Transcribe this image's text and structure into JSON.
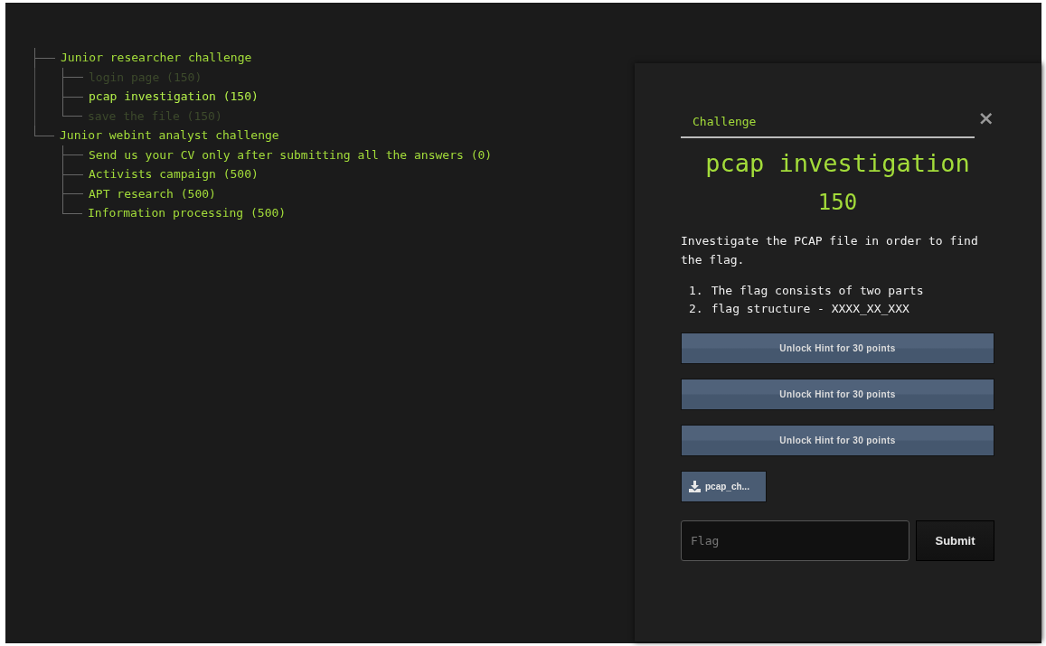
{
  "tree": [
    {
      "label": "Junior researcher challenge",
      "children": [
        {
          "label": "login page (150)",
          "disabled": true,
          "selected": false
        },
        {
          "label": "pcap investigation (150)",
          "disabled": false,
          "selected": true
        },
        {
          "label": "save the file (150)",
          "disabled": true,
          "selected": false
        }
      ]
    },
    {
      "label": "Junior webint analyst challenge",
      "children": [
        {
          "label": "Send us your CV only after submitting all the answers (0)",
          "disabled": false,
          "selected": false
        },
        {
          "label": "Activists campaign (500)",
          "disabled": false,
          "selected": false
        },
        {
          "label": "APT research (500)",
          "disabled": false,
          "selected": false
        },
        {
          "label": "Information processing (500)",
          "disabled": false,
          "selected": false
        }
      ]
    }
  ],
  "modal": {
    "header": "Challenge",
    "close": "×",
    "title": "pcap investigation",
    "points": "150",
    "description": "Investigate the PCAP file in order to find the flag.",
    "notes": [
      {
        "number": "1.",
        "text": "The flag consists of two parts"
      },
      {
        "number": "2.",
        "text": "flag structure - XXXX_XX_XXX"
      }
    ],
    "hints": [
      "Unlock Hint for 30 points",
      "Unlock Hint for 30 points",
      "Unlock Hint for 30 points"
    ],
    "file": "pcap_ch...",
    "flag": {
      "placeholder": "Flag"
    },
    "submit": "Submit"
  }
}
